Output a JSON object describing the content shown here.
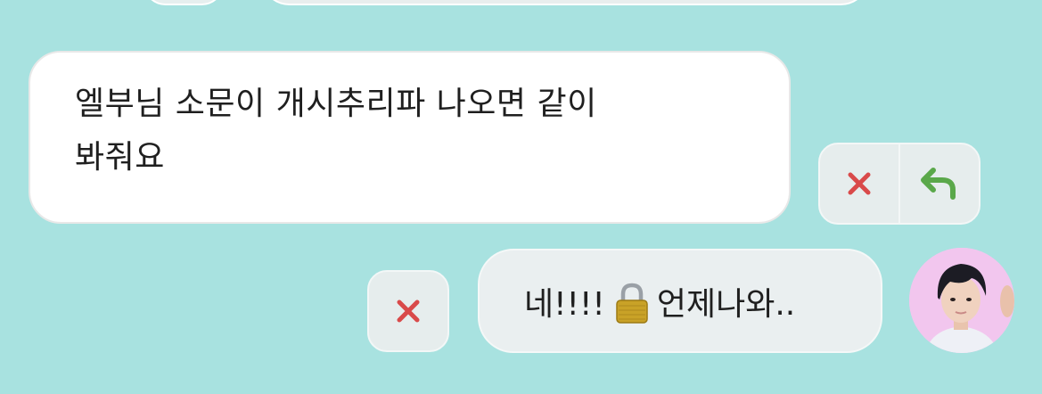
{
  "messages": {
    "received": {
      "line1": "엘부님 소문이 개시추리파 나오면 같이",
      "line2": "봐줘요"
    },
    "sent": {
      "before_icon": "네!!!!",
      "icon": "lock-icon",
      "after_icon": "언제나와.."
    }
  },
  "actions": {
    "delete_icon": "close-icon",
    "reply_icon": "reply-icon"
  },
  "colors": {
    "background": "#a8e2e0",
    "delete": "#d94a4a",
    "reply": "#5aa84a",
    "avatar_bg": "#f3c8f0"
  }
}
